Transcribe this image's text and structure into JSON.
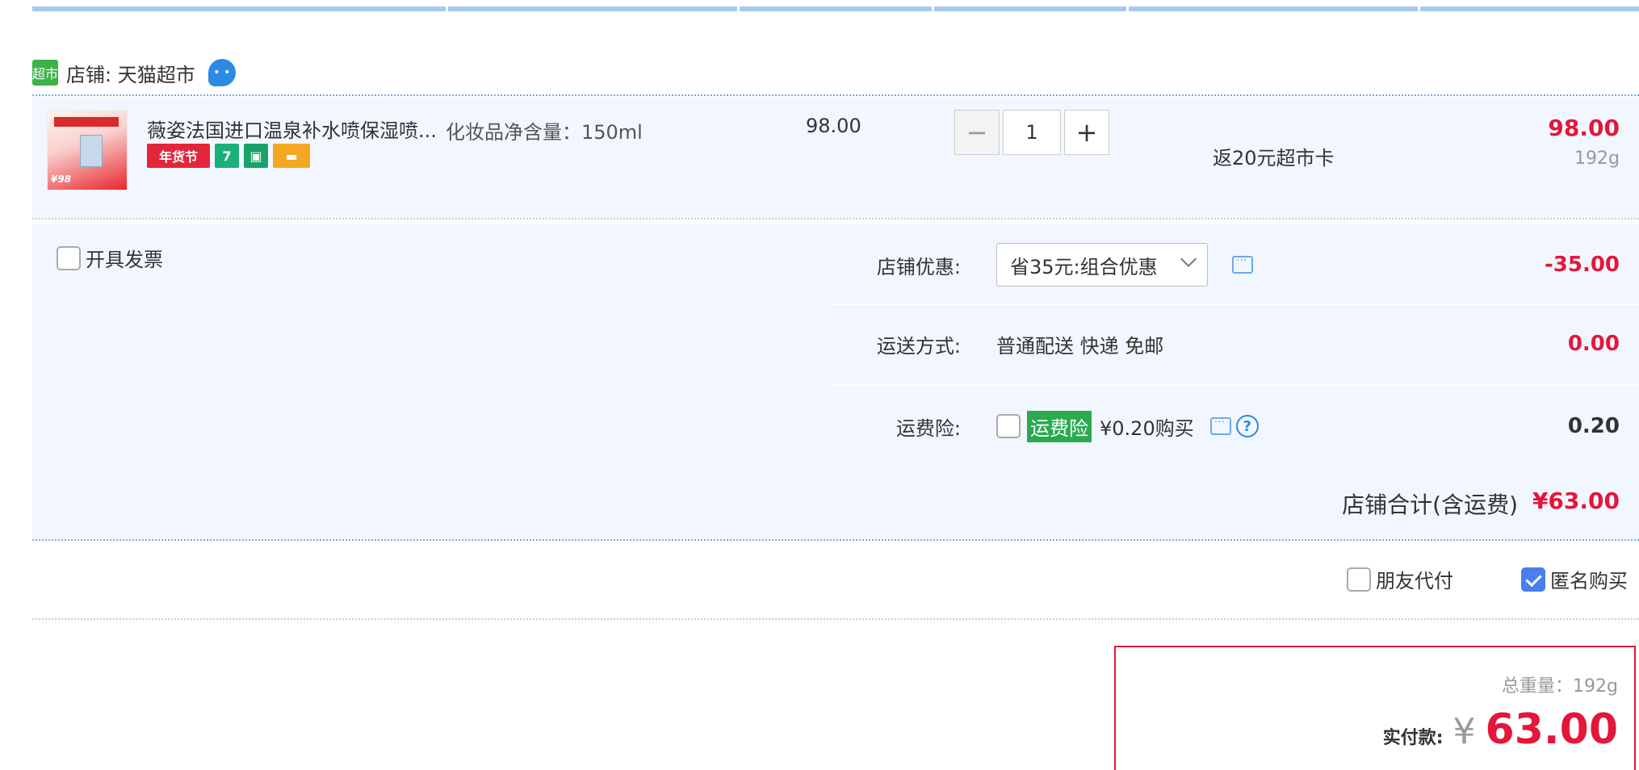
{
  "shop": {
    "badge": "超市",
    "name": "店铺: 天猫超市",
    "chat_icon": "ww-icon"
  },
  "item": {
    "title": "薇姿法国进口温泉补水喷保湿喷...",
    "tags": [
      "年货节",
      "7",
      "bag-icon",
      "card-icon"
    ],
    "tag_text_nh": "年货节",
    "tag_text_7": "7",
    "spec": "化妆品净含量：150ml",
    "unit_price": "98.00",
    "quantity": "1",
    "promo": "返20元超市卡",
    "subtotal": "98.00",
    "weight": "192g"
  },
  "invoice": {
    "label": "开具发票"
  },
  "discount": {
    "label": "店铺优惠:",
    "selected": "省35元:组合优惠",
    "amount": "-35.00"
  },
  "shipping": {
    "label": "运送方式:",
    "method": "普通配送 快递 免邮",
    "amount": "0.00"
  },
  "insurance": {
    "label": "运费险:",
    "badge": "运费险",
    "price": "¥0.20购买",
    "amount": "0.20"
  },
  "shop_total": {
    "label": "店铺合计(含运费)",
    "amount": "¥63.00"
  },
  "options": {
    "friend_pay": "朋友代付",
    "anonymous": "匿名购买",
    "anonymous_checked": true
  },
  "summary": {
    "weight": "总重量：192g",
    "pay_label": "实付款:",
    "currency": "¥",
    "pay_amount": "63.00"
  },
  "colors": {
    "accent_red": "#e4163a",
    "panel_bg": "#f2f7ff",
    "check_blue": "#4a7ef0",
    "insurance_green": "#2aaa4f"
  }
}
